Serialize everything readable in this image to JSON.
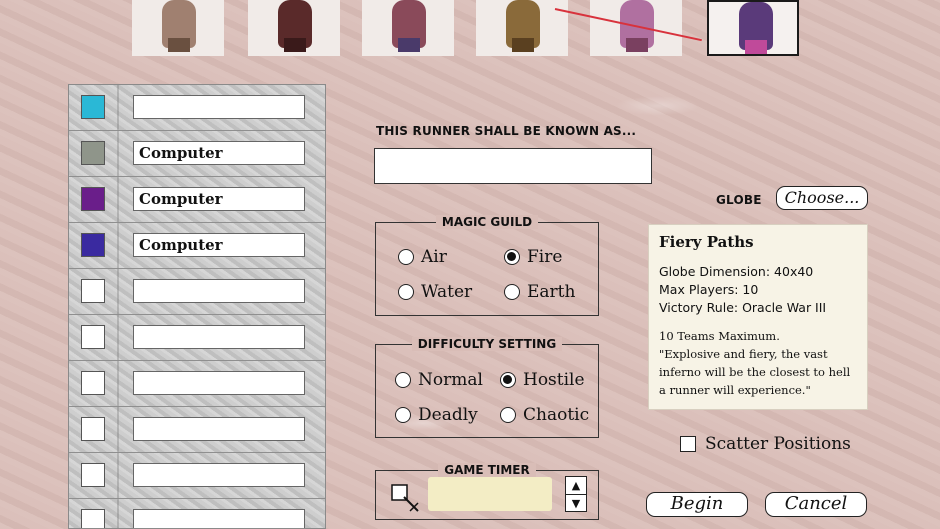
{
  "portraits": [
    {
      "name": "runner-portrait-1",
      "color": "#a08070"
    },
    {
      "name": "runner-portrait-2",
      "color": "#5a2a2a"
    },
    {
      "name": "runner-portrait-3",
      "color": "#8a4a5a"
    },
    {
      "name": "runner-portrait-4",
      "color": "#8a6a3a"
    },
    {
      "name": "runner-portrait-5",
      "color": "#b070a0"
    },
    {
      "name": "runner-portrait-6",
      "color": "#5a3a7a",
      "selected": true
    }
  ],
  "players": [
    {
      "color": "#2ab8d6",
      "name": ""
    },
    {
      "color": "#8f958a",
      "name": "Computer"
    },
    {
      "color": "#6a1e8a",
      "name": "Computer"
    },
    {
      "color": "#3a2aa0",
      "name": "Computer"
    },
    {
      "color": "#ffffff",
      "name": ""
    },
    {
      "color": "#ffffff",
      "name": ""
    },
    {
      "color": "#ffffff",
      "name": ""
    },
    {
      "color": "#ffffff",
      "name": ""
    },
    {
      "color": "#ffffff",
      "name": ""
    },
    {
      "color": "#ffffff",
      "name": ""
    }
  ],
  "runner": {
    "heading": "THIS RUNNER SHALL BE KNOWN AS...",
    "value": ""
  },
  "globe": {
    "label": "GLOBE",
    "choose_label": "Choose..."
  },
  "magic_guild": {
    "title": "MAGIC GUILD",
    "options": [
      "Air",
      "Fire",
      "Water",
      "Earth"
    ],
    "selected": "Fire"
  },
  "difficulty": {
    "title": "DIFFICULTY SETTING",
    "options": [
      "Normal",
      "Hostile",
      "Deadly",
      "Chaotic"
    ],
    "selected": "Hostile"
  },
  "game_timer": {
    "title": "GAME TIMER",
    "value": ""
  },
  "globe_info": {
    "title": "Fiery Paths",
    "dimension": "Globe Dimension: 40x40",
    "max_players": "Max Players: 10",
    "victory_rule": "Victory Rule: Oracle War III",
    "teams": "10 Teams Maximum.",
    "description": "\"Explosive and fiery, the vast inferno will be the closest to hell a runner will experience.\""
  },
  "scatter": {
    "label": "Scatter Positions",
    "checked": false
  },
  "buttons": {
    "begin": "Begin",
    "cancel": "Cancel"
  },
  "colors": {
    "accent_rope": "#d8323c",
    "info_bg": "#f7f3e6",
    "timer_bg": "#f3edc5"
  }
}
